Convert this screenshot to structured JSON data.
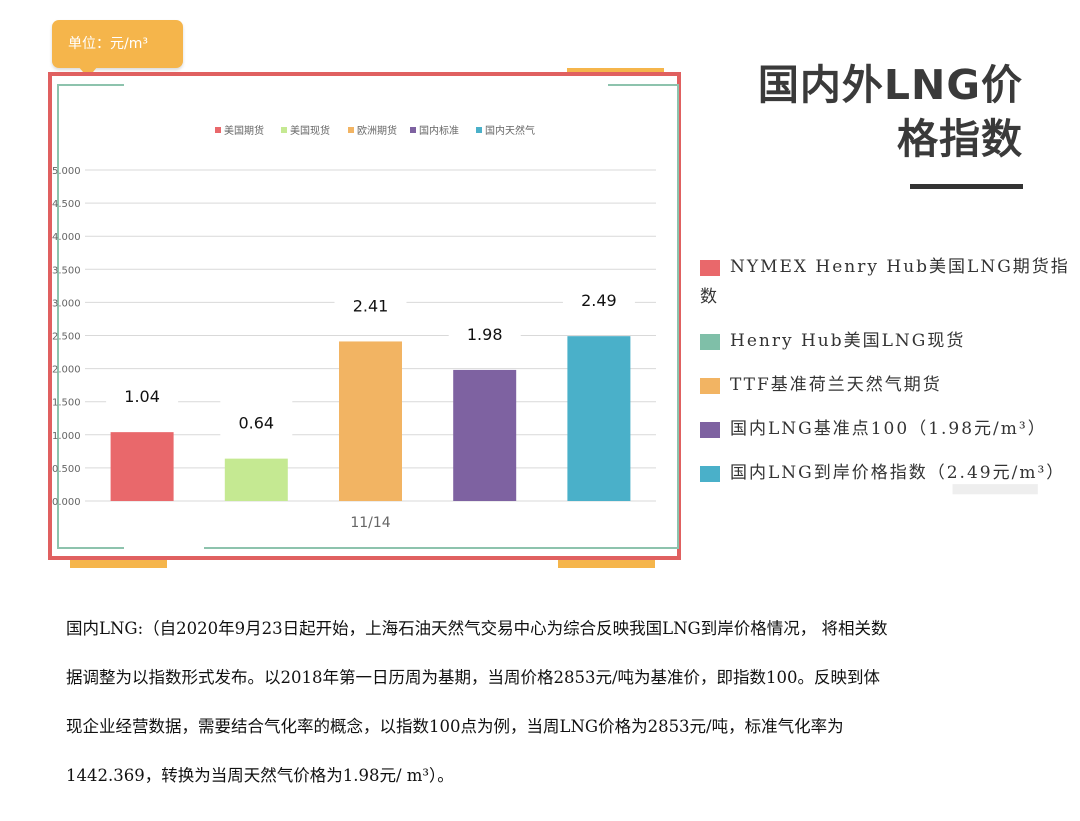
{
  "page": {
    "unit_label": "单位：元/m³",
    "title_line1": "国内外LNG价",
    "title_line2": "格指数",
    "paragraph_lines": [
      "国内LNG:（自2020年9月23日起开始，上海石油天然气交易中心为综合反映我国LNG到岸价格情况， 将相关数",
      "据调整为以指数形式发布。以2018年第一日历周为基期，当周价格2853元/吨为基准价，即指数100。反映到体",
      "现企业经营数据，需要结合气化率的概念，以指数100点为例，当周LNG价格为2853元/吨，标准气化率为",
      "1442.369，转换为当周天然气价格为1.98元/ m³）。"
    ],
    "side_legend": [
      {
        "label": "NYMEX Henry Hub美国LNG期货指数",
        "color": "#e9686b"
      },
      {
        "label": "Henry Hub美国LNG现货",
        "color": "#7fbfa8"
      },
      {
        "label": "TTF基准荷兰天然气期货",
        "color": "#f2b463"
      },
      {
        "label": "国内LNG基准点100（1.98元/m³）",
        "color": "#7e62a1"
      },
      {
        "label": "国内LNG到岸价格指数（2.49元/m³）",
        "color": "#4ab0c9"
      }
    ]
  },
  "chart_data": {
    "type": "bar",
    "categories": [
      "11/14"
    ],
    "series": [
      {
        "name": "美国期货",
        "values": [
          1.04
        ],
        "color": "#e9686b"
      },
      {
        "name": "美国现货",
        "values": [
          0.64
        ],
        "color": "#c5e992"
      },
      {
        "name": "欧洲期货",
        "values": [
          2.41
        ],
        "color": "#f2b463"
      },
      {
        "name": "国内标准",
        "values": [
          1.98
        ],
        "color": "#7e62a1"
      },
      {
        "name": "国内天然气",
        "values": [
          2.49
        ],
        "color": "#4ab0c9"
      }
    ],
    "data_labels": [
      "1.04",
      "0.64",
      "2.41",
      "1.98",
      "2.49"
    ],
    "yticks": [
      "0.000",
      "0.500",
      "1.000",
      "1.500",
      "2.000",
      "2.500",
      "3.000",
      "3.500",
      "4.000",
      "4.500",
      "5.000"
    ],
    "ylim": [
      0,
      5
    ],
    "legend_position": "top",
    "grid": true
  }
}
